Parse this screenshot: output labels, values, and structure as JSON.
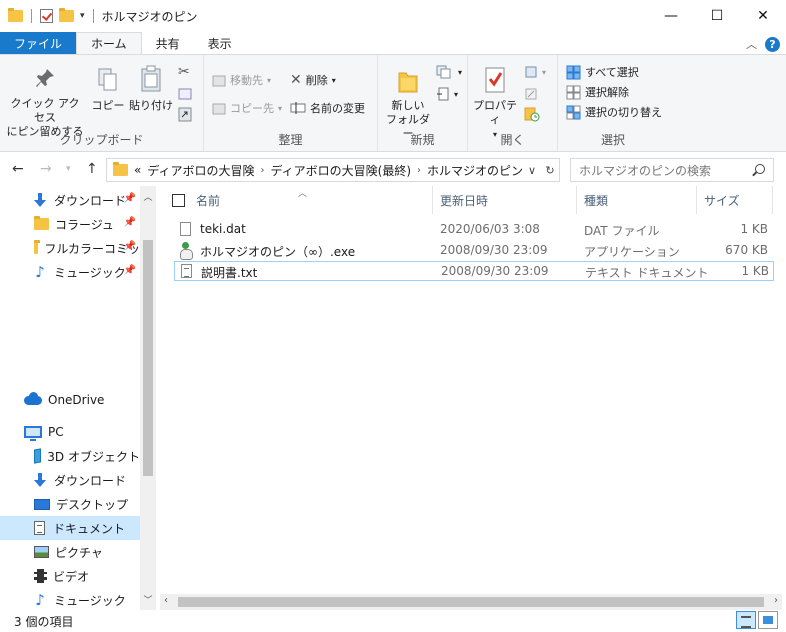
{
  "window": {
    "title": "ホルマジオのピン",
    "controls": {
      "minimize": "—",
      "maximize": "☐",
      "close": "✕"
    }
  },
  "ribbon_tabs": [
    {
      "label": "ファイル"
    },
    {
      "label": "ホーム"
    },
    {
      "label": "共有"
    },
    {
      "label": "表示"
    }
  ],
  "ribbon": {
    "clipboard": {
      "label": "クリップボード",
      "pin_quick_access": "クイック アクセス\nにピン留めする",
      "copy": "コピー",
      "paste": "貼り付け"
    },
    "organize": {
      "label": "整理",
      "move_to": "移動先",
      "copy_to": "コピー先",
      "delete": "削除",
      "rename": "名前の変更"
    },
    "new": {
      "label": "新規",
      "new_folder": "新しい\nフォルダー"
    },
    "open": {
      "label": "開く",
      "properties": "プロパティ"
    },
    "select": {
      "label": "選択",
      "select_all": "すべて選択",
      "select_none": "選択解除",
      "invert": "選択の切り替え"
    }
  },
  "address": {
    "overflow": "«",
    "crumbs": [
      "ディアボロの大冒険",
      "ディアボロの大冒険(最終)",
      "ホルマジオのピン"
    ],
    "search_placeholder": "ホルマジオのピンの検索"
  },
  "nav_pane": {
    "quick_access": [
      {
        "label": "ダウンロード",
        "icon": "download-icon"
      },
      {
        "label": "コラージュ",
        "icon": "folder-icon"
      },
      {
        "label": "フルカラーコミッ",
        "icon": "folder-icon"
      },
      {
        "label": "ミュージック",
        "icon": "music-icon"
      }
    ],
    "onedrive": "OneDrive",
    "pc": "PC",
    "pc_items": [
      {
        "label": "3D オブジェクト",
        "icon": "3d-objects-icon"
      },
      {
        "label": "ダウンロード",
        "icon": "download-icon"
      },
      {
        "label": "デスクトップ",
        "icon": "desktop-icon"
      },
      {
        "label": "ドキュメント",
        "icon": "documents-icon",
        "selected": true
      },
      {
        "label": "ピクチャ",
        "icon": "pictures-icon"
      },
      {
        "label": "ビデオ",
        "icon": "videos-icon"
      },
      {
        "label": "ミュージック",
        "icon": "music-icon"
      }
    ]
  },
  "file_list": {
    "columns": [
      "名前",
      "更新日時",
      "種類",
      "サイズ"
    ],
    "rows": [
      {
        "name": "teki.dat",
        "modified": "2020/06/03 3:08",
        "type": "DAT ファイル",
        "size": "1 KB",
        "icon": "file-icon"
      },
      {
        "name": "ホルマジオのピン（∞）.exe",
        "modified": "2008/09/30 23:09",
        "type": "アプリケーション",
        "size": "670 KB",
        "icon": "exe-icon"
      },
      {
        "name": "説明書.txt",
        "modified": "2008/09/30 23:09",
        "type": "テキスト ドキュメント",
        "size": "1 KB",
        "icon": "text-file-icon",
        "selected": true
      }
    ]
  },
  "status": {
    "item_count": "3 個の項目"
  },
  "colors": {
    "accent": "#1979ca",
    "selection": "#cce8ff",
    "folder": "#f5c447"
  }
}
